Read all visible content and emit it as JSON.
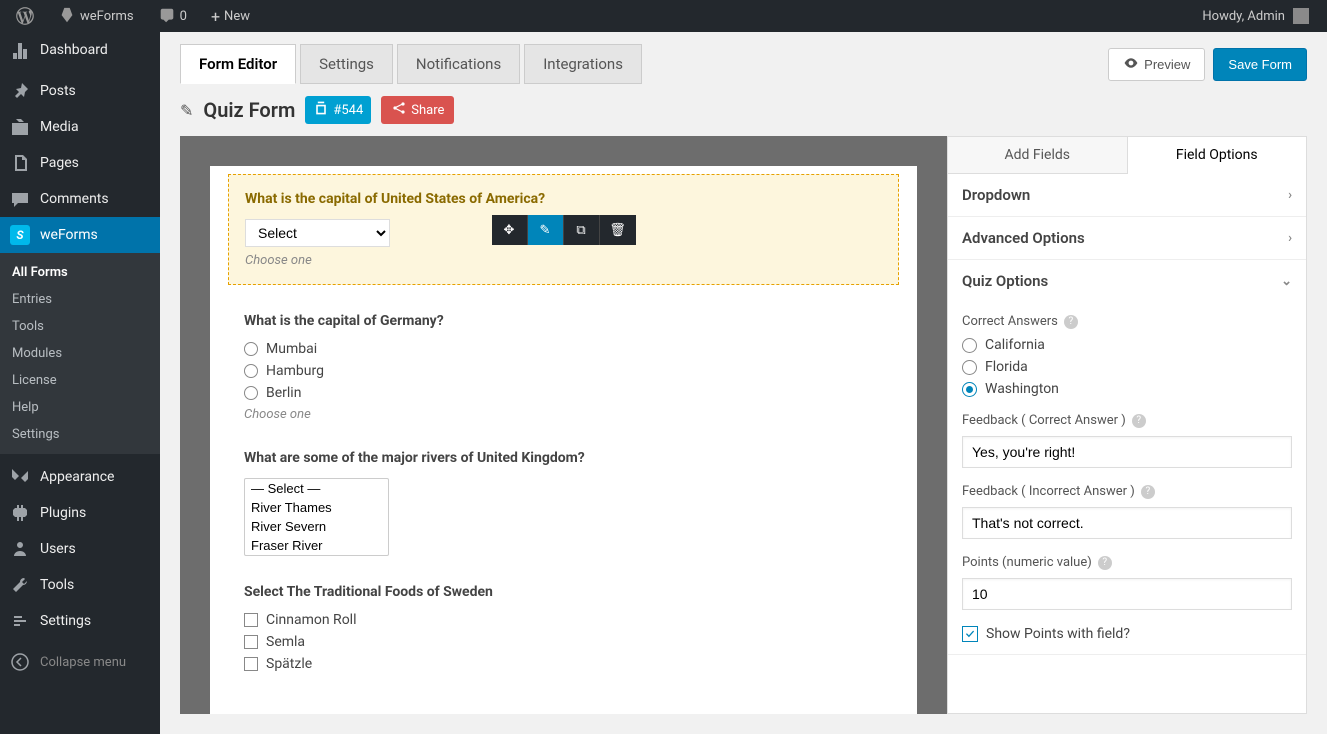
{
  "adminbar": {
    "site": "weForms",
    "comments": "0",
    "new": "New",
    "howdy": "Howdy, Admin"
  },
  "sidebar": {
    "items": [
      {
        "label": "Dashboard",
        "icon": "dashboard"
      },
      {
        "label": "Posts",
        "icon": "pin"
      },
      {
        "label": "Media",
        "icon": "media"
      },
      {
        "label": "Pages",
        "icon": "pages"
      },
      {
        "label": "Comments",
        "icon": "comment"
      },
      {
        "label": "weForms",
        "icon": "weforms",
        "current": true
      },
      {
        "label": "Appearance",
        "icon": "appearance"
      },
      {
        "label": "Plugins",
        "icon": "plugin"
      },
      {
        "label": "Users",
        "icon": "users"
      },
      {
        "label": "Tools",
        "icon": "tools"
      },
      {
        "label": "Settings",
        "icon": "settings"
      }
    ],
    "submenu": [
      "All Forms",
      "Entries",
      "Tools",
      "Modules",
      "License",
      "Help",
      "Settings"
    ],
    "collapse": "Collapse menu"
  },
  "header": {
    "tabs": [
      "Form Editor",
      "Settings",
      "Notifications",
      "Integrations"
    ],
    "preview": "Preview",
    "save": "Save Form",
    "title": "Quiz Form",
    "form_id": "#544",
    "share": "Share"
  },
  "canvas": {
    "q1": {
      "label": "What is the capital of United States of America?",
      "select": "Select",
      "help": "Choose one"
    },
    "q2": {
      "label": "What is the capital of Germany?",
      "options": [
        "Mumbai",
        "Hamburg",
        "Berlin"
      ],
      "help": "Choose one"
    },
    "q3": {
      "label": "What are some of the major rivers of United Kingdom?",
      "options": [
        "— Select —",
        "River Thames",
        "River Severn",
        "Fraser River"
      ]
    },
    "q4": {
      "label": "Select The Traditional Foods of Sweden",
      "options": [
        "Cinnamon Roll",
        "Semla",
        "Spätzle"
      ]
    }
  },
  "sidepanel": {
    "tabs": [
      "Add Fields",
      "Field Options"
    ],
    "acc1": "Dropdown",
    "acc2": "Advanced Options",
    "acc3": "Quiz Options",
    "correct_label": "Correct Answers",
    "answers": [
      "California",
      "Florida",
      "Washington"
    ],
    "selected_index": 2,
    "fb_correct_label": "Feedback ( Correct Answer )",
    "fb_correct_value": "Yes, you're right!",
    "fb_wrong_label": "Feedback ( Incorrect Answer )",
    "fb_wrong_value": "That's not correct.",
    "points_label": "Points (numeric value)",
    "points_value": "10",
    "show_points": "Show Points with field?"
  }
}
